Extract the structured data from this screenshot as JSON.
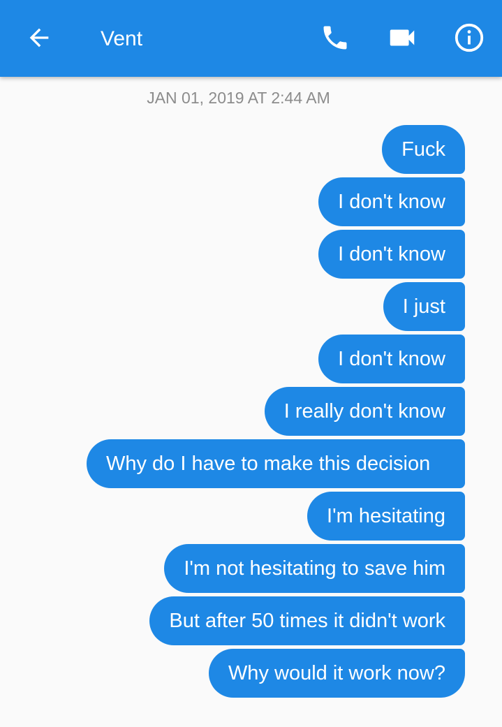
{
  "header": {
    "title": "Vent",
    "back_icon": "arrow-left-icon",
    "call_icon": "phone-icon",
    "video_icon": "video-camera-icon",
    "info_icon": "info-icon",
    "background_color": "#1e88e5"
  },
  "conversation": {
    "timestamp": "JAN 01, 2019 AT 2:44 AM",
    "bubble_color": "#1e88e5",
    "messages": [
      "Fuck",
      "I don't know",
      "I don't know",
      "I just",
      "I don't know",
      "I really don't know",
      "Why do I have to make this decision",
      "I'm hesitating",
      "I'm not hesitating to save him",
      "But after 50 times it didn't work",
      "Why would it work now?"
    ]
  }
}
